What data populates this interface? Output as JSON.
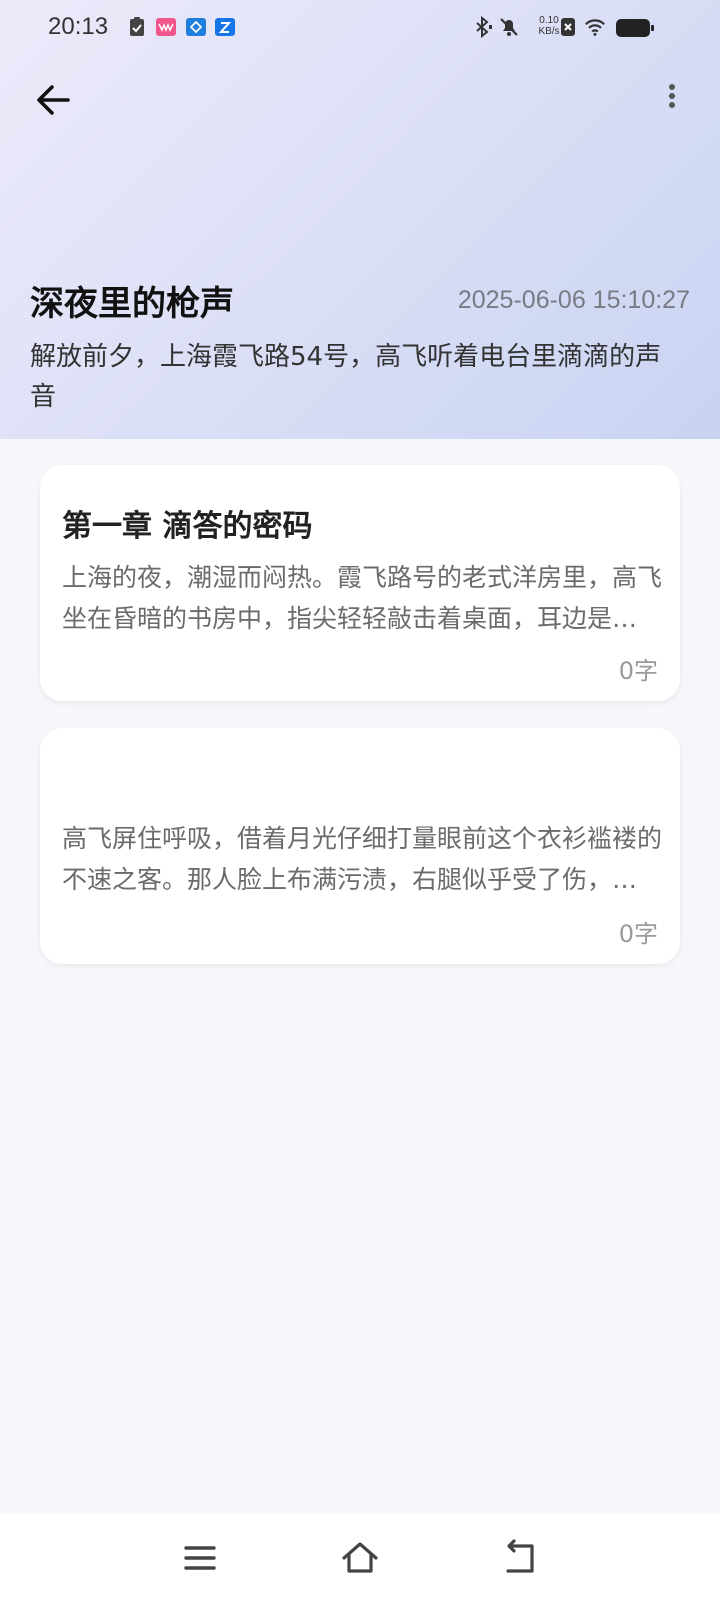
{
  "status_bar": {
    "time": "20:13",
    "net_speed_value": "0.10",
    "net_speed_unit": "KB/s",
    "icons": [
      "checkmark-clipboard-icon",
      "pink-app-icon",
      "blue-app-icon",
      "z-app-icon",
      "bluetooth-icon",
      "mute-bell-icon",
      "sim-x-icon",
      "wifi-icon",
      "battery-icon"
    ]
  },
  "header": {
    "title": "深夜里的枪声",
    "date": "2025-06-06 15:10:27",
    "description": "解放前夕，上海霞飞路54号，高飞听着电台里滴滴的声音"
  },
  "chapters": [
    {
      "title": "第一章 滴答的密码",
      "excerpt": "上海的夜，潮湿而闷热。霞飞路号的老式洋房里，高飞坐在昏暗的书房中，指尖轻轻敲击着桌面，耳边是电台里断断续续的滴答声。",
      "word_count": "0字"
    },
    {
      "title": "",
      "excerpt": "高飞屏住呼吸，借着月光仔细打量眼前这个衣衫褴褛的不速之客。那人脸上布满污渍，右腿似乎受了伤，正一瘸一拐地靠在墙边。",
      "word_count": "0字"
    }
  ],
  "colors": {
    "header_gradient_start": "#eceafa",
    "header_gradient_end": "#c9d3f2",
    "background": "#f6f7fa"
  }
}
